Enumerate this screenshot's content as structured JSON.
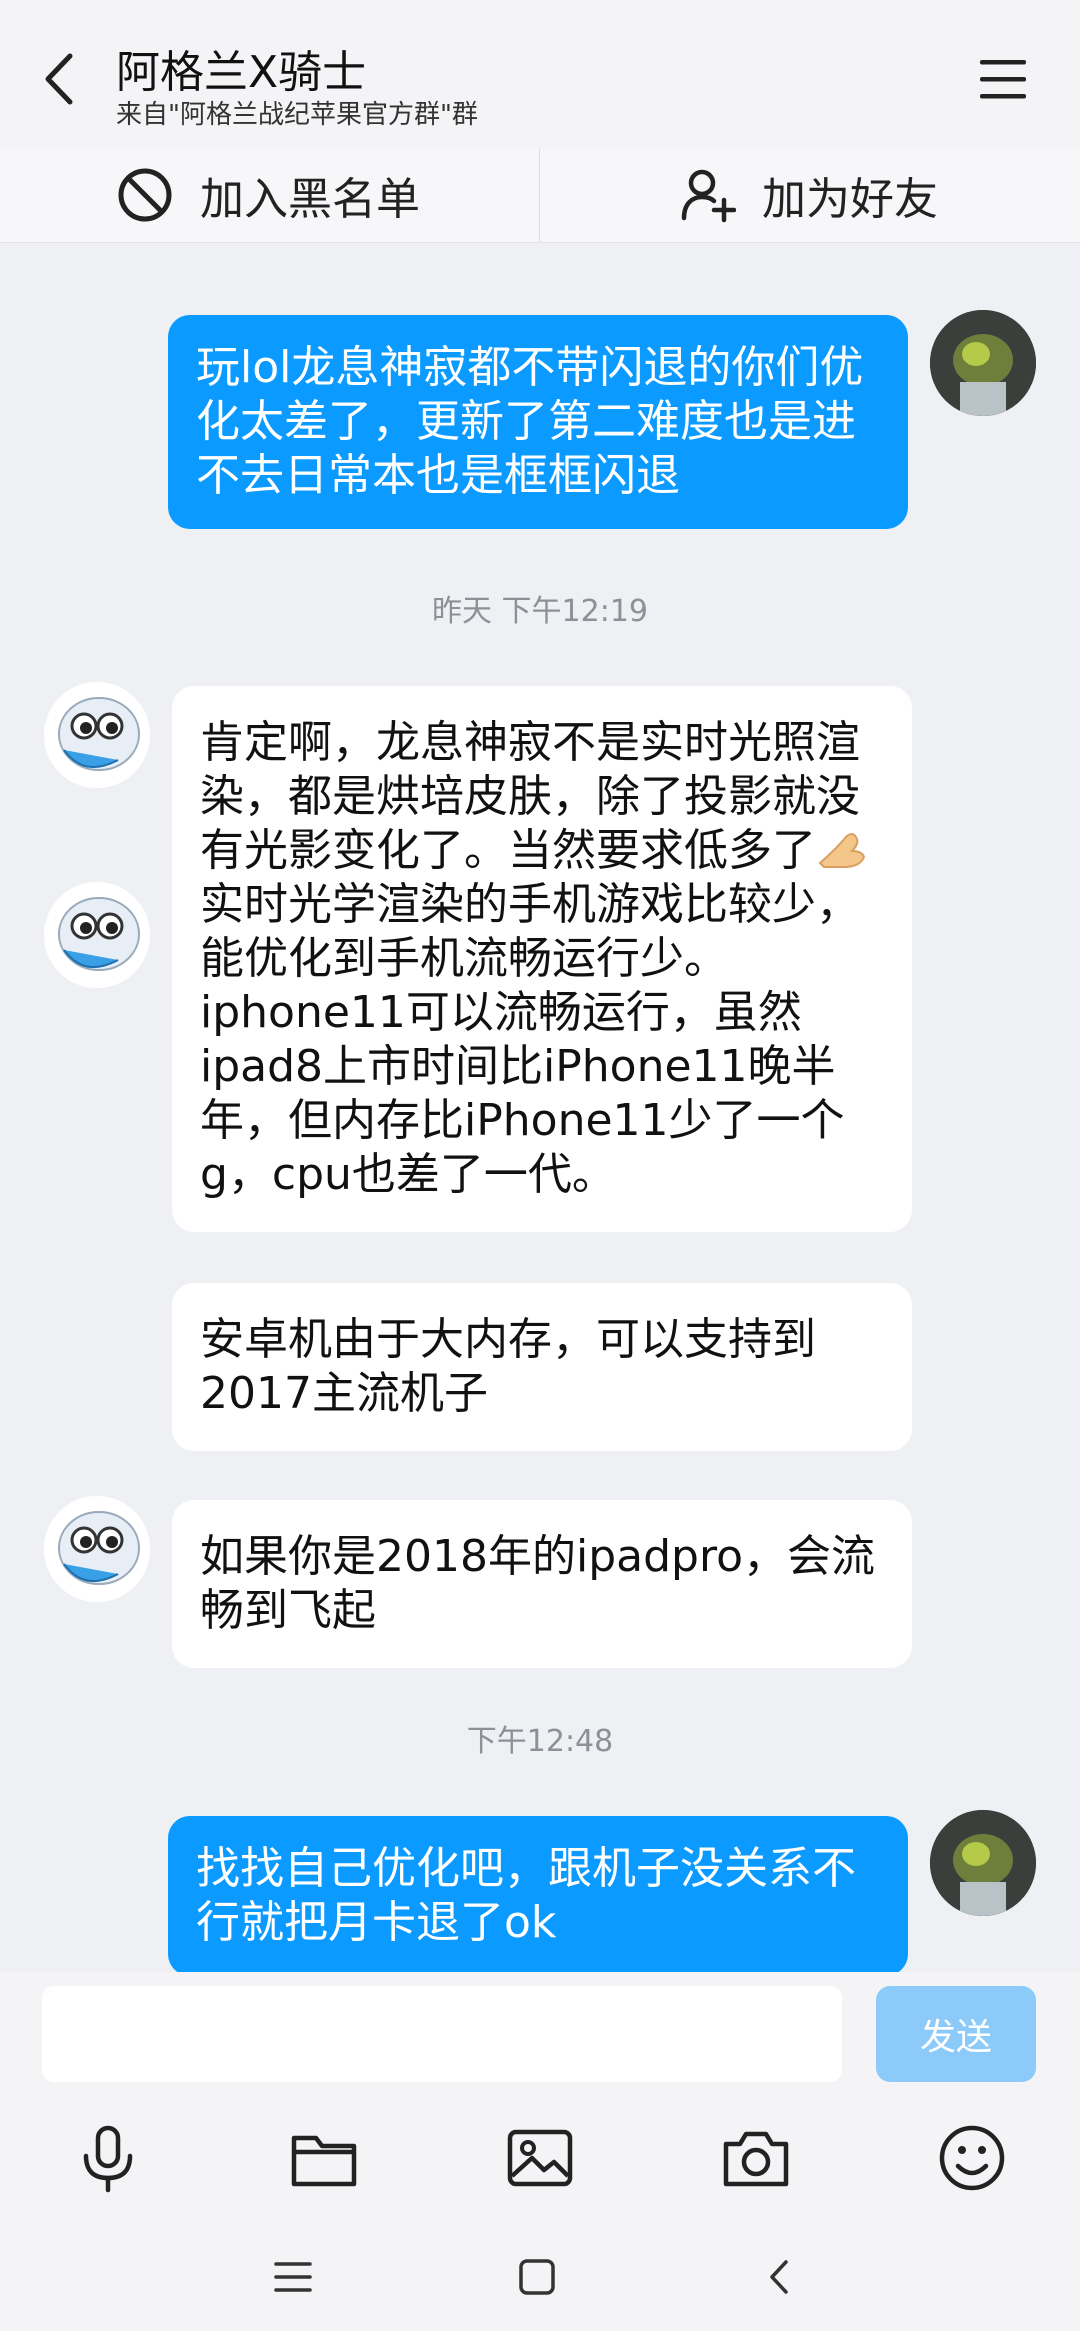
{
  "header": {
    "title": "阿格兰X骑士",
    "subtitle": "来自\"阿格兰战纪苹果官方群\"群"
  },
  "actions": {
    "blacklist_label": "加入黑名单",
    "add_friend_label": "加为好友"
  },
  "chat": {
    "timestamp_1": "昨天 下午12:19",
    "timestamp_2": "下午12:48",
    "messages": [
      {
        "from": "me",
        "text": "玩lol龙息神寂都不带闪退的你们优化太差了，更新了第二难度也是进不去日常本也是框框闪退"
      },
      {
        "from": "other",
        "text_before_emoji": "肯定啊，龙息神寂不是实时光照渲染，都是烘培皮肤，除了投影就没有光影变化了。当然要求低多了",
        "emoji": "hand-emoji",
        "text_after_emoji": "实时光学渲染的手机游戏比较少，能优化到手机流畅运行少。iphone11可以流畅运行，虽然ipad8上市时间比iPhone11晚半年，但内存比iPhone11少了一个g，cpu也差了一代。"
      },
      {
        "from": "other",
        "text": "安卓机由于大内存，可以支持到2017主流机子"
      },
      {
        "from": "other",
        "text": "如果你是2018年的ipadpro，会流畅到飞起"
      },
      {
        "from": "me",
        "text": "找找自己优化吧，跟机子没关系不行就把月卡退了ok"
      }
    ]
  },
  "input": {
    "value": "",
    "send_label": "发送"
  },
  "toolbar": [
    "microphone-icon",
    "folder-icon",
    "image-icon",
    "camera-icon",
    "emoji-icon"
  ],
  "navbar": [
    "menu-icon",
    "home-icon",
    "back-icon"
  ],
  "colors": {
    "outgoing_bubble": "#0b9aff",
    "incoming_bubble": "#ffffff",
    "background": "#eff0f4",
    "send_button": "#8ccafa"
  }
}
